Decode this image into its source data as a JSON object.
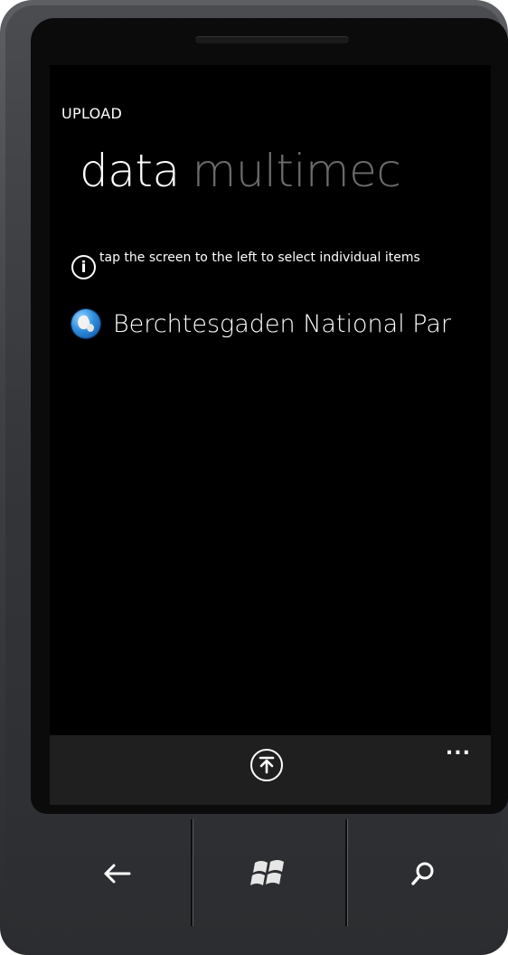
{
  "app": {
    "title": "UPLOAD"
  },
  "pivot": {
    "active": "data",
    "next": "multimec"
  },
  "info": {
    "icon": "info-icon",
    "text": "tap the screen to the left to select individual items"
  },
  "list": {
    "items": [
      {
        "label": "Berchtesgaden National Par",
        "icon": "globe-icon"
      }
    ]
  },
  "appbar": {
    "button_icon": "upload-icon",
    "more_label": "..."
  },
  "hardware_keys": {
    "back_icon": "back-arrow-icon",
    "start_icon": "windows-logo-icon",
    "search_icon": "search-icon"
  },
  "colors": {
    "background": "#000000",
    "appbar": "#1f1f1f",
    "inactive_pivot": "#6c6c6c",
    "text": "#ffffff"
  }
}
